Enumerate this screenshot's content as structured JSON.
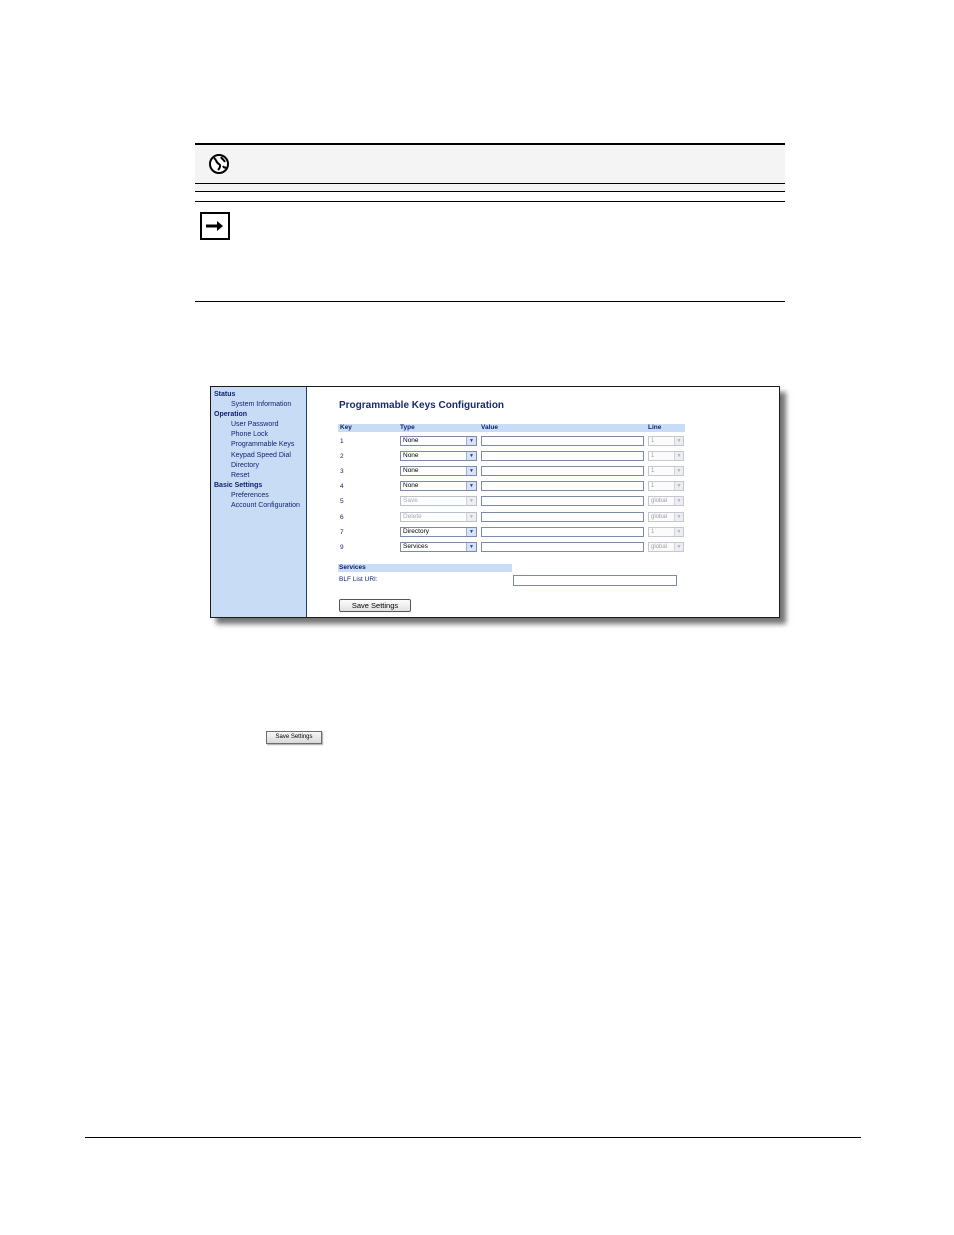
{
  "sidebar": {
    "sections": [
      {
        "title": "Status",
        "items": [
          "System Information"
        ]
      },
      {
        "title": "Operation",
        "items": [
          "User Password",
          "Phone Lock",
          "Programmable Keys",
          "Keypad Speed Dial",
          "Directory",
          "Reset"
        ]
      },
      {
        "title": "Basic Settings",
        "items": [
          "Preferences",
          "Account Configuration"
        ]
      }
    ]
  },
  "main": {
    "title": "Programmable Keys Configuration",
    "headers": {
      "key": "Key",
      "type": "Type",
      "value": "Value",
      "line": "Line"
    },
    "rows": [
      {
        "key": "1",
        "type": "None",
        "line": "1",
        "disabled": false
      },
      {
        "key": "2",
        "type": "None",
        "line": "1",
        "disabled": false
      },
      {
        "key": "3",
        "type": "None",
        "line": "1",
        "disabled": false
      },
      {
        "key": "4",
        "type": "None",
        "line": "1",
        "disabled": false
      },
      {
        "key": "5",
        "type": "Save",
        "line": "global",
        "disabled": true
      },
      {
        "key": "6",
        "type": "Delete",
        "line": "global",
        "disabled": true
      },
      {
        "key": "7",
        "type": "Directory",
        "line": "1",
        "disabled": false
      },
      {
        "key": "9",
        "type": "Services",
        "line": "global",
        "disabled": false
      }
    ],
    "services": {
      "title": "Services",
      "blf_label": "BLF List URI:"
    },
    "save_label": "Save Settings"
  },
  "inline_button": {
    "label": "Save Settings"
  },
  "icons": {
    "webui": "globe-icon",
    "note": "arrow-right-icon",
    "dropdown": "chevron-down-icon"
  }
}
